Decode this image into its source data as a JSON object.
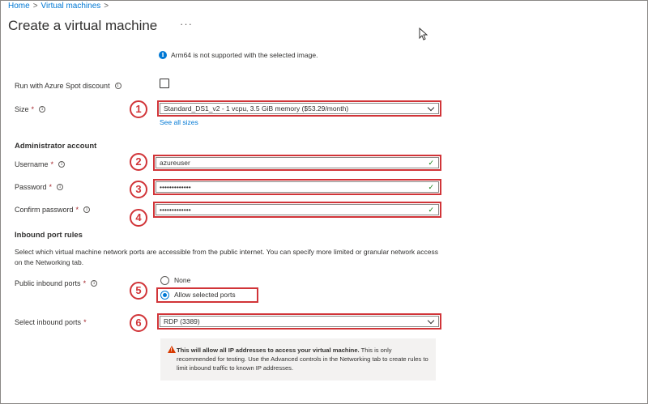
{
  "breadcrumb": {
    "home": "Home",
    "sep": ">",
    "current": "Virtual machines",
    "sep2": ">"
  },
  "page": {
    "title": "Create a virtual machine",
    "more": "···"
  },
  "notice": {
    "text": "Arm64 is not supported with the selected image."
  },
  "spot": {
    "label": "Run with Azure Spot discount",
    "checked": false
  },
  "size": {
    "label": "Size",
    "value": "Standard_DS1_v2 - 1 vcpu, 3.5 GiB memory ($53.29/month)",
    "link": "See all sizes",
    "badge": "1"
  },
  "admin": {
    "heading": "Administrator account",
    "username": {
      "label": "Username",
      "value": "azureuser",
      "badge": "2"
    },
    "password": {
      "label": "Password",
      "value": "•••••••••••••",
      "badge": "3"
    },
    "confirm": {
      "label": "Confirm password",
      "value": "•••••••••••••",
      "badge": "4"
    }
  },
  "inbound": {
    "heading": "Inbound port rules",
    "description": "Select which virtual machine network ports are accessible from the public internet. You can specify more limited or granular network access on the Networking tab.",
    "public_label": "Public inbound ports",
    "option_none": "None",
    "option_allow": "Allow selected ports",
    "selected_option": "Allow selected ports",
    "radio_badge": "5",
    "select_label": "Select inbound ports",
    "select_value": "RDP (3389)",
    "select_badge": "6"
  },
  "warning": {
    "bold": "This will allow all IP addresses to access your virtual machine.",
    "text": " This is only recommended for testing.  Use the Advanced controls in the Networking tab to create rules to limit inbound traffic to known IP addresses."
  },
  "required_mark": "*",
  "info_glyph": "i",
  "check_glyph": "✓",
  "colors": {
    "accent": "#0078d4",
    "highlight": "#d13438",
    "success": "#107c10",
    "warning": "#d83b01"
  },
  "icons": {
    "info": "info-icon",
    "check": "checkmark-icon",
    "chevron": "chevron-down-icon",
    "warning": "warning-icon",
    "cursor": "mouse-cursor-icon"
  }
}
